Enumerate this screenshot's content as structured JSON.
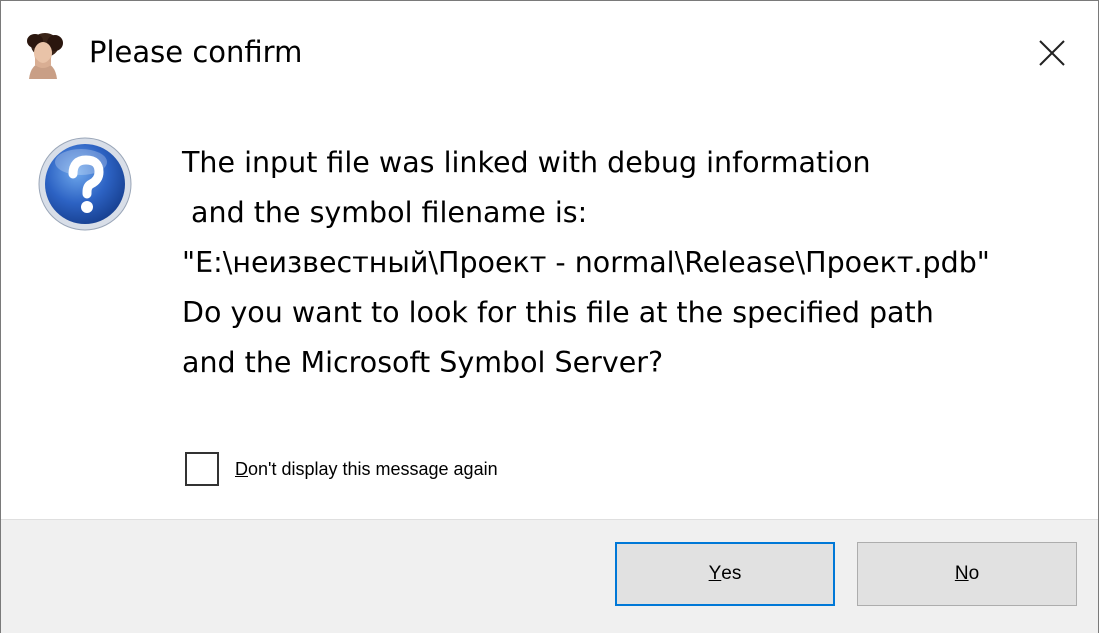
{
  "window": {
    "title": "Please confirm",
    "app_icon": "portrait-icon",
    "close_icon": "close-icon"
  },
  "message": {
    "icon": "question-icon",
    "lines": [
      "The input file was linked with debug information",
      " and the symbol filename is:",
      "\"E:\\неизвестный\\Проект - normal\\Release\\Проект.pdb\"",
      "Do you want to look for this file at the specified path",
      "and the Microsoft Symbol Server?"
    ]
  },
  "checkbox": {
    "label_first": "D",
    "label_rest": "on't display this message again",
    "checked": false
  },
  "buttons": {
    "yes_first": "Y",
    "yes_rest": "es",
    "no_first": "N",
    "no_rest": "o"
  },
  "colors": {
    "accent": "#0078d7",
    "footer_bg": "#f0f0f0",
    "button_bg": "#e1e1e1"
  }
}
